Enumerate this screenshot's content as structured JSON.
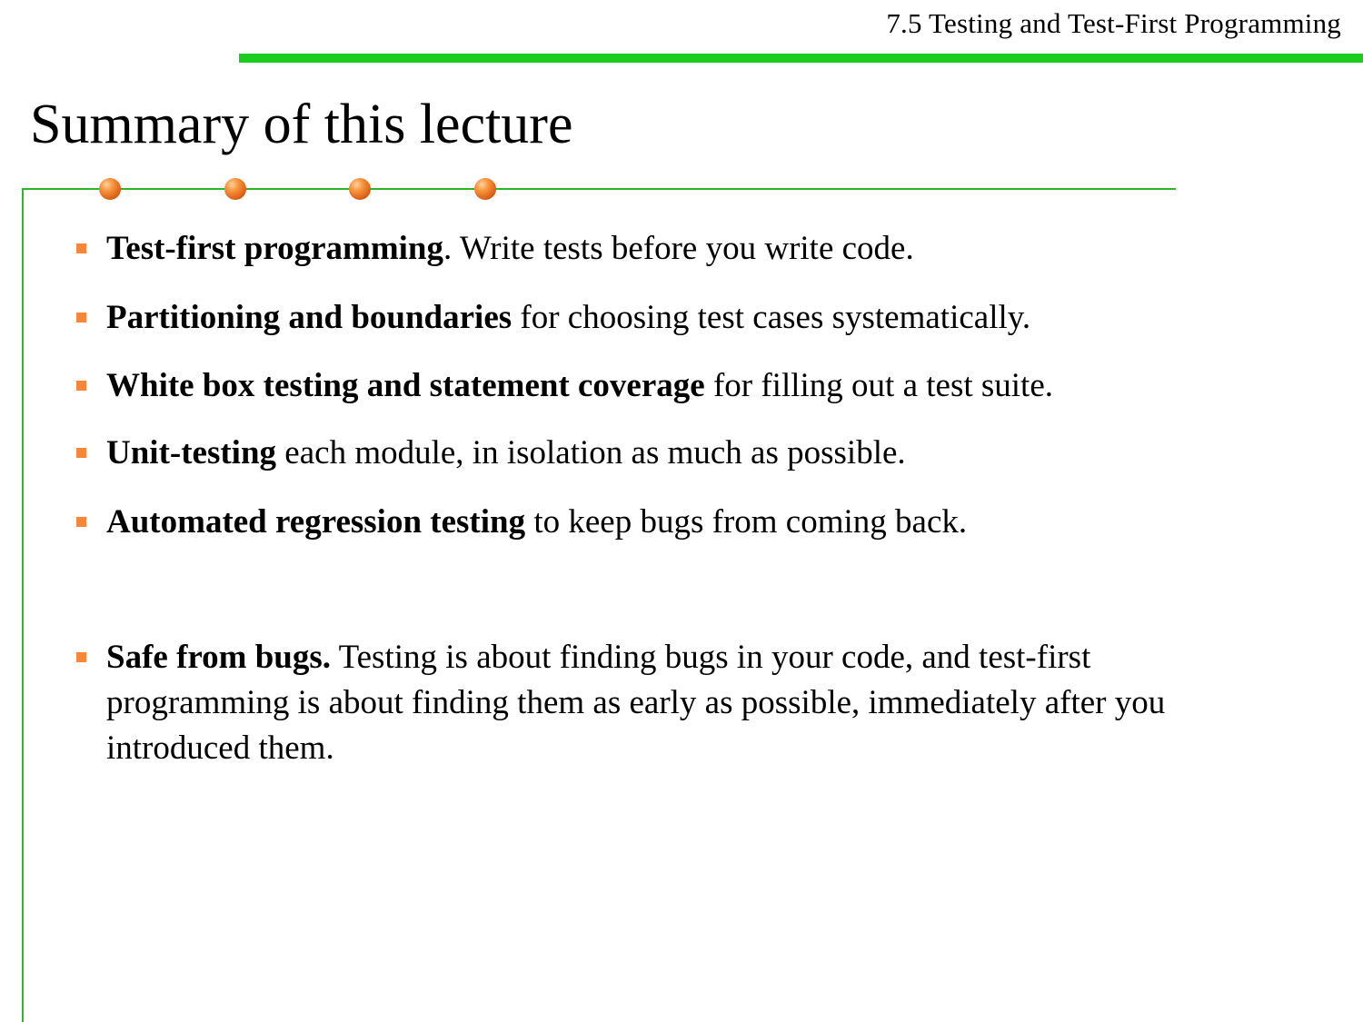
{
  "header": {
    "section_title": "7.5 Testing and Test-First Programming",
    "accent_color": "#1ecc1e"
  },
  "slide": {
    "title": "Summary of this lecture",
    "frame_color": "#2bb52b",
    "dot_color": "#f0802a",
    "bullet_color": "#f5863a"
  },
  "bullets": [
    {
      "bold": "Test-first programming",
      "text": ". Write tests before you write code."
    },
    {
      "bold": "Partitioning and boundaries",
      "text": " for choosing test cases systematically."
    },
    {
      "bold": "White box testing and statement coverage",
      "text": " for filling out a test suite."
    },
    {
      "bold": "Unit-testing",
      "text": " each module, in isolation as much as possible."
    },
    {
      "bold": "Automated regression testing",
      "text": " to keep bugs from coming back."
    },
    {
      "bold": "Safe from bugs.",
      "text": " Testing is about finding bugs in your code, and test-first programming is about finding them as early as possible, immediately after you introduced them."
    }
  ]
}
